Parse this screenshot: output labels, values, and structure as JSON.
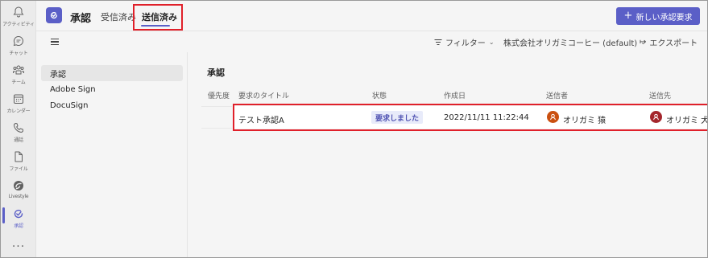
{
  "rail": {
    "items": [
      {
        "label": "アクティビティ",
        "icon": "bell-icon"
      },
      {
        "label": "チャット",
        "icon": "chat-icon"
      },
      {
        "label": "チーム",
        "icon": "teams-icon"
      },
      {
        "label": "カレンダー",
        "icon": "calendar-icon"
      },
      {
        "label": "通話",
        "icon": "phone-icon"
      },
      {
        "label": "ファイル",
        "icon": "file-icon"
      },
      {
        "label": "Livestyle",
        "icon": "livestyle-icon"
      },
      {
        "label": "承認",
        "icon": "approvals-icon"
      }
    ],
    "more": "..."
  },
  "header": {
    "app_title": "承認",
    "tabs": [
      {
        "label": "受信済み"
      },
      {
        "label": "送信済み"
      }
    ],
    "new_button": "新しい承認要求",
    "accent_color": "#5b5fc7"
  },
  "toolbar": {
    "filter": "フィルター",
    "org": "株式会社オリガミコーヒー (default)",
    "export": "エクスポート"
  },
  "subnav": {
    "items": [
      {
        "label": "承認"
      },
      {
        "label": "Adobe Sign"
      },
      {
        "label": "DocuSign"
      }
    ]
  },
  "main": {
    "section_title": "承認",
    "columns": [
      "優先度",
      "要求のタイトル",
      "状態",
      "作成日",
      "送信者",
      "送信先"
    ],
    "rows": [
      {
        "title": "テスト承認A",
        "status": "要求しました",
        "created": "2022/11/11 11:22:44",
        "sender": "オリガミ 猿",
        "sender_color": "#ca5010",
        "recipient": "オリガミ 犬",
        "recipient_color": "#a4262c"
      }
    ]
  },
  "annotation_color": "#e0202a"
}
